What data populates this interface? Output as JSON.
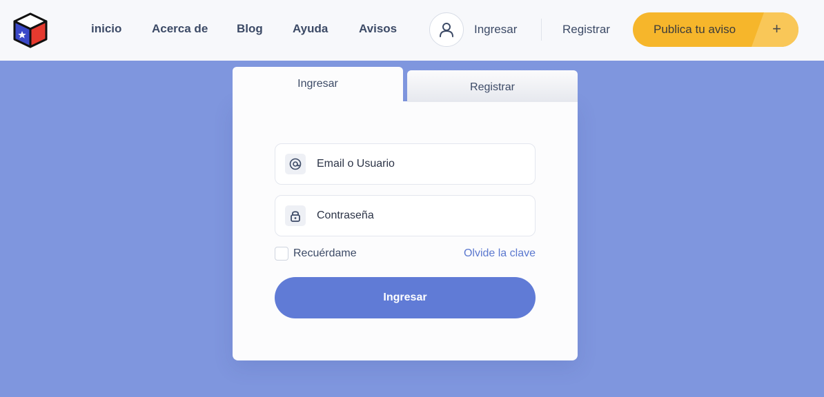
{
  "header": {
    "nav": [
      "inicio",
      "Acerca de",
      "Blog",
      "Ayuda",
      "Avisos"
    ],
    "login_link": "Ingresar",
    "register_link": "Registrar",
    "publish_button": "Publica tu aviso",
    "publish_plus": "+"
  },
  "tabs": {
    "login": "Ingresar",
    "register": "Registrar"
  },
  "form": {
    "email_placeholder": "Email o Usuario",
    "password_placeholder": "Contraseña",
    "remember_label": "Recuérdame",
    "remember_checked": false,
    "forgot_link": "Olvide la clave",
    "submit_label": "Ingresar"
  },
  "icons": {
    "logo": "cube-logo-icon",
    "user": "user-icon",
    "email": "at-sign-icon",
    "password": "lock-icon"
  },
  "colors": {
    "background": "#7f96de",
    "header": "#f7f8fb",
    "accent_yellow": "#f6b62b",
    "primary_button": "#607bd6",
    "link": "#5b78cf"
  }
}
